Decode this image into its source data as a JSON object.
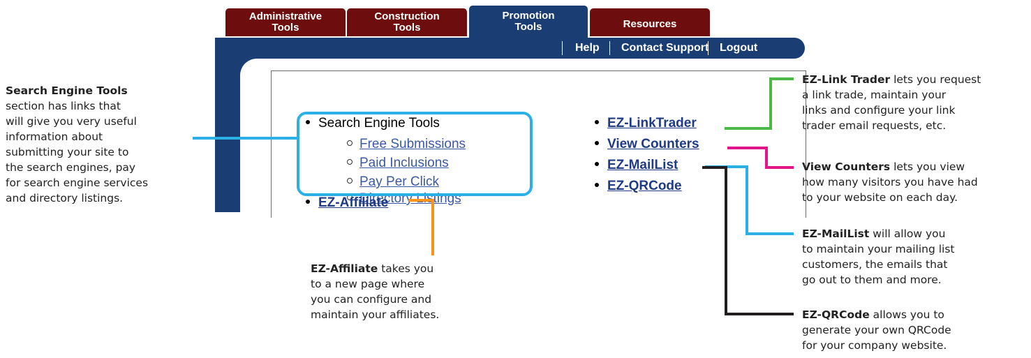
{
  "tabs": [
    {
      "line1": "Administrative",
      "line2": "Tools"
    },
    {
      "line1": "Construction",
      "line2": "Tools"
    },
    {
      "line1": "Promotion",
      "line2": "Tools"
    },
    {
      "line1": "Resources",
      "line2": ""
    }
  ],
  "toplinks": {
    "help": "Help",
    "contact": "Contact Support",
    "logout": "Logout"
  },
  "content": {
    "search_heading": "Search Engine Tools",
    "sub_links": [
      "Free Submissions",
      "Paid Inclusions",
      "Pay Per Click",
      "Directory Listings"
    ],
    "ez_affiliate": "EZ-Affiliate",
    "right_links": [
      "EZ-LinkTrader",
      "View Counters",
      "EZ-MailList",
      "EZ-QRCode"
    ]
  },
  "annotations": {
    "search": {
      "title": "Search Engine Tools",
      "lines": [
        "section has links that",
        "will give you very useful",
        "information about",
        "submitting your site to",
        "the search engines, pay",
        "for search engine services",
        "and directory listings."
      ]
    },
    "affiliate": {
      "title": "EZ-Affiliate",
      "rest": " takes you",
      "lines": [
        "to a new page where",
        "you can configure and",
        "maintain your affiliates."
      ]
    },
    "linktrader": {
      "title": "EZ-Link Trader",
      "rest": " lets you request",
      "lines": [
        "a link trade, maintain your",
        "links and configure your link",
        "trader email requests, etc."
      ]
    },
    "counters": {
      "title": "View Counters",
      "rest": " lets you view",
      "lines": [
        "how many visitors you have had",
        "to your website on each day."
      ]
    },
    "maillist": {
      "title": "EZ-MailList",
      "rest": " will allow you",
      "lines": [
        "to maintain your mailing list",
        "customers, the emails that",
        "go out to them and more."
      ]
    },
    "qrcode": {
      "title": "EZ-QRCode",
      "rest": " allows you to",
      "lines": [
        "generate your own QRCode",
        "for your company website."
      ]
    }
  },
  "colors": {
    "tab_inactive": "#6e0d0d",
    "navy": "#1a3e74",
    "cyan": "#2bb0e6",
    "green": "#4cb848",
    "magenta": "#e2168a",
    "orange": "#f7941d",
    "black": "#231f20",
    "link": "#1f3b86"
  }
}
